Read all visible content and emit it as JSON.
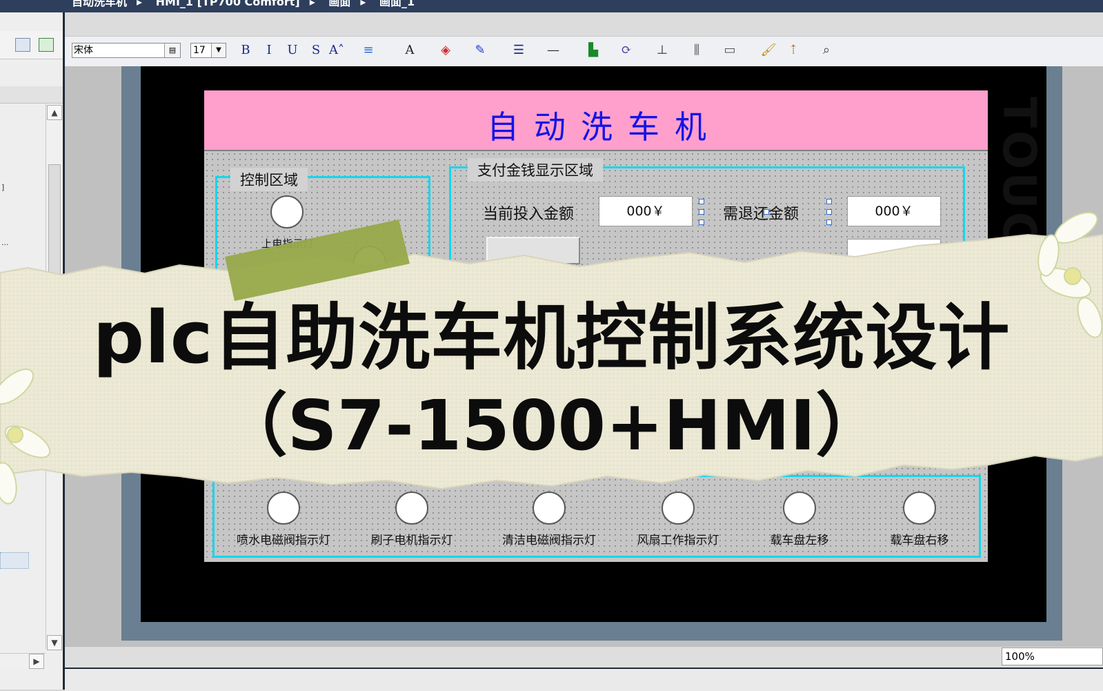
{
  "window": {
    "breadcrumbs": [
      "自动洗车机",
      "HMI_1 [TP700 Comfort]",
      "画面",
      "画面_1"
    ]
  },
  "toolbar": {
    "font_name": "宋体",
    "font_size": "17",
    "buttons": [
      {
        "icon": "bold-icon",
        "glyph": "B"
      },
      {
        "icon": "italic-icon",
        "glyph": "I"
      },
      {
        "icon": "underline-icon",
        "glyph": "U"
      },
      {
        "icon": "strikethrough-icon",
        "glyph": "S"
      },
      {
        "icon": "font-grow-icon",
        "glyph": "A˄"
      },
      {
        "icon": "align-icon",
        "glyph": "≡"
      },
      {
        "icon": "font-color-icon",
        "glyph": "A"
      },
      {
        "icon": "fill-color-icon",
        "glyph": "◈"
      },
      {
        "icon": "line-color-icon",
        "glyph": "✎"
      },
      {
        "icon": "line-width-icon",
        "glyph": "☰"
      },
      {
        "icon": "line-style-icon",
        "glyph": "—"
      },
      {
        "icon": "layer-icon",
        "glyph": "▙"
      },
      {
        "icon": "rotate-icon",
        "glyph": "⟳"
      },
      {
        "icon": "align-objects-icon",
        "glyph": "⊥"
      },
      {
        "icon": "distribute-icon",
        "glyph": "⫼"
      },
      {
        "icon": "same-size-icon",
        "glyph": "▭"
      },
      {
        "icon": "format-painter-icon",
        "glyph": "🖌"
      },
      {
        "icon": "bring-front-icon",
        "glyph": "⇡"
      },
      {
        "icon": "zoom-select-icon",
        "glyph": "⌕"
      }
    ]
  },
  "hmi": {
    "title": "自动洗车机",
    "control_area": {
      "label": "控制区域",
      "lamp_label": "上电指示灯"
    },
    "payment_area": {
      "label": "支付金钱显示区域",
      "current_amount_label": "当前投入金额",
      "current_amount_value": "000￥",
      "refund_label": "需退还金额",
      "refund_value": "000￥"
    },
    "indicator_area": {
      "lamps": [
        {
          "label": "喷水电磁阀指示灯"
        },
        {
          "label": "刷子电机指示灯"
        },
        {
          "label": "清洁电磁阀指示灯"
        },
        {
          "label": "风扇工作指示灯"
        },
        {
          "label": "载车盘左移"
        },
        {
          "label": "载车盘右移"
        }
      ]
    },
    "device_brand": "TOUC"
  },
  "status": {
    "zoom": "100%"
  },
  "overlay": {
    "line1": "plc自助洗车机控制系统设计",
    "line2": "（S7-1500+HMI）"
  },
  "colors": {
    "header_pink": "#ff9fcc",
    "title_blue": "#1414e6",
    "frame_cyan": "#12d6ee",
    "paper": "#ece9d6",
    "paper_green": "#97a94a"
  }
}
